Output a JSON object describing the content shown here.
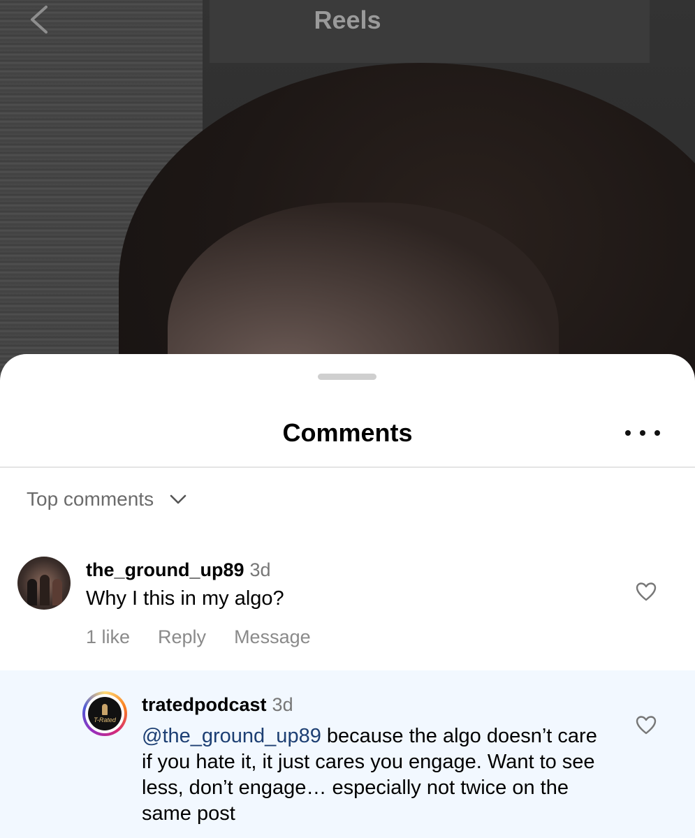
{
  "header": {
    "title": "Reels"
  },
  "sheet": {
    "title": "Comments",
    "sort_label": "Top comments"
  },
  "comments": [
    {
      "username": "the_ground_up89",
      "time": "3d",
      "text": "Why I this in my algo?",
      "likes_label": "1 like",
      "reply_label": "Reply",
      "message_label": "Message"
    },
    {
      "username": "tratedpodcast",
      "time": "3d",
      "mention": "@the_ground_up89",
      "text": " because the algo doesn’t care if you hate it, it just cares you engage. Want to see less, don’t engage… especially not twice on the same post",
      "avatar_text": "T-Rated"
    }
  ],
  "icons": {
    "back": "chevron-left-icon",
    "more": "ellipsis-icon",
    "sort": "chevron-down-icon",
    "like": "heart-icon"
  },
  "colors": {
    "mention": "#1d3f73",
    "reply_highlight": "#f2f8ff"
  }
}
